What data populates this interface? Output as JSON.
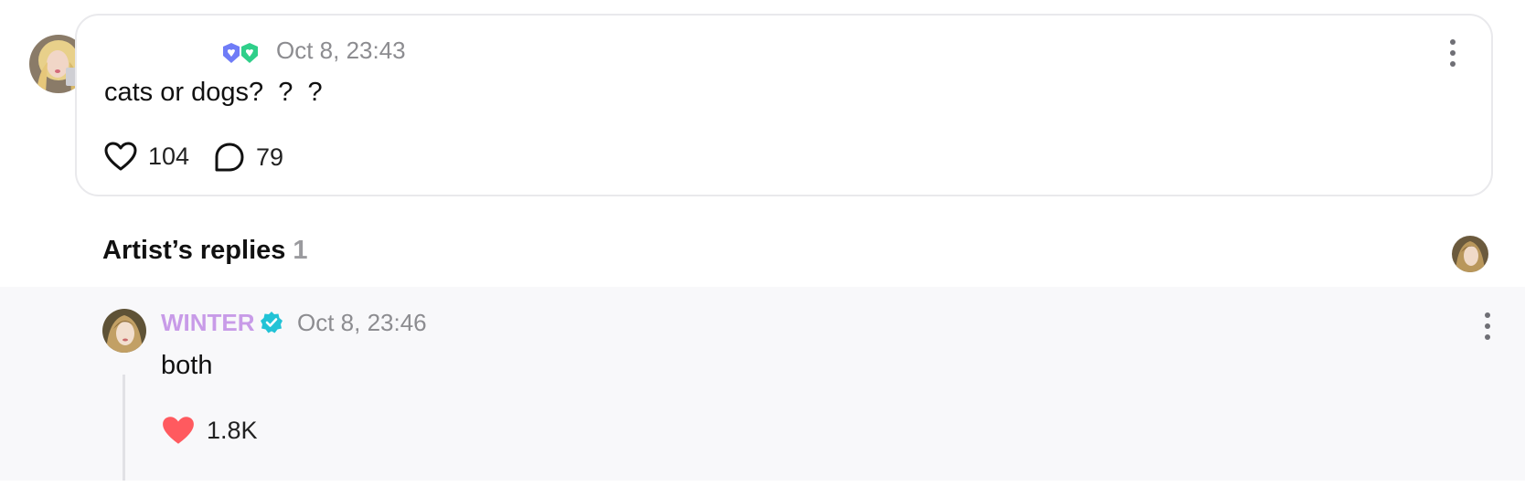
{
  "post": {
    "author_avatar_alt": "user avatar",
    "time": "Oct 8, 23:43",
    "text": "cats or dogs?  ?  ?",
    "likes": "104",
    "comments": "79",
    "badge_colors": [
      "#6f7cf7",
      "#2fcf8a"
    ]
  },
  "replies": {
    "title": "Artist’s replies",
    "count": "1"
  },
  "reply": {
    "author": "WINTER",
    "time": "Oct 8, 23:46",
    "text": "both",
    "likes": "1.8K",
    "name_color": "#c89be8",
    "verified_color": "#22c3d6",
    "liked_color": "#ff5a5f"
  },
  "icons": [
    "heart-outline-icon",
    "comment-bubble-icon",
    "heart-filled-icon",
    "verified-icon",
    "more-vertical-icon"
  ]
}
